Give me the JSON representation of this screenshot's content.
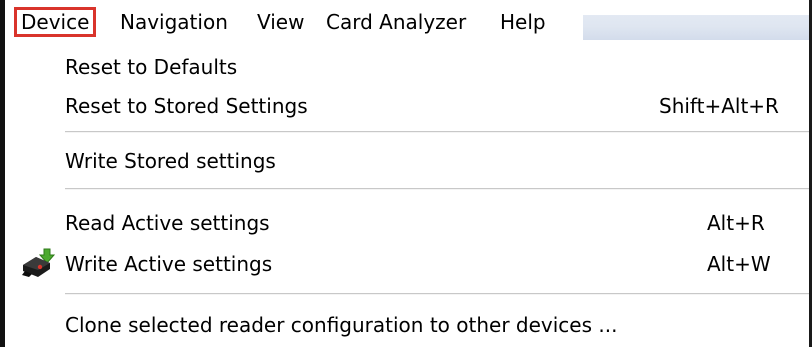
{
  "menubar": {
    "items": [
      {
        "label": "Device",
        "active": true
      },
      {
        "label": "Navigation",
        "active": false
      },
      {
        "label": "View",
        "active": false
      },
      {
        "label": "Card Analyzer",
        "active": false
      },
      {
        "label": "Help",
        "active": false
      }
    ]
  },
  "dropdown": {
    "items": [
      {
        "label": "Reset to Defaults",
        "shortcut": ""
      },
      {
        "label": "Reset to Stored Settings",
        "shortcut": "Shift+Alt+R"
      },
      {
        "label": "Write Stored settings",
        "shortcut": ""
      },
      {
        "label": "Read Active settings",
        "shortcut": "Alt+R"
      },
      {
        "label": "Write Active settings",
        "shortcut": "Alt+W",
        "icon": "reader-device-icon"
      },
      {
        "label": "Clone selected reader configuration to other devices ...",
        "shortcut": ""
      }
    ]
  },
  "colors": {
    "active_menu_outline": "#d9342b",
    "menubar_gradient": "#dfe6f1",
    "separator": "#c8c8c8"
  }
}
